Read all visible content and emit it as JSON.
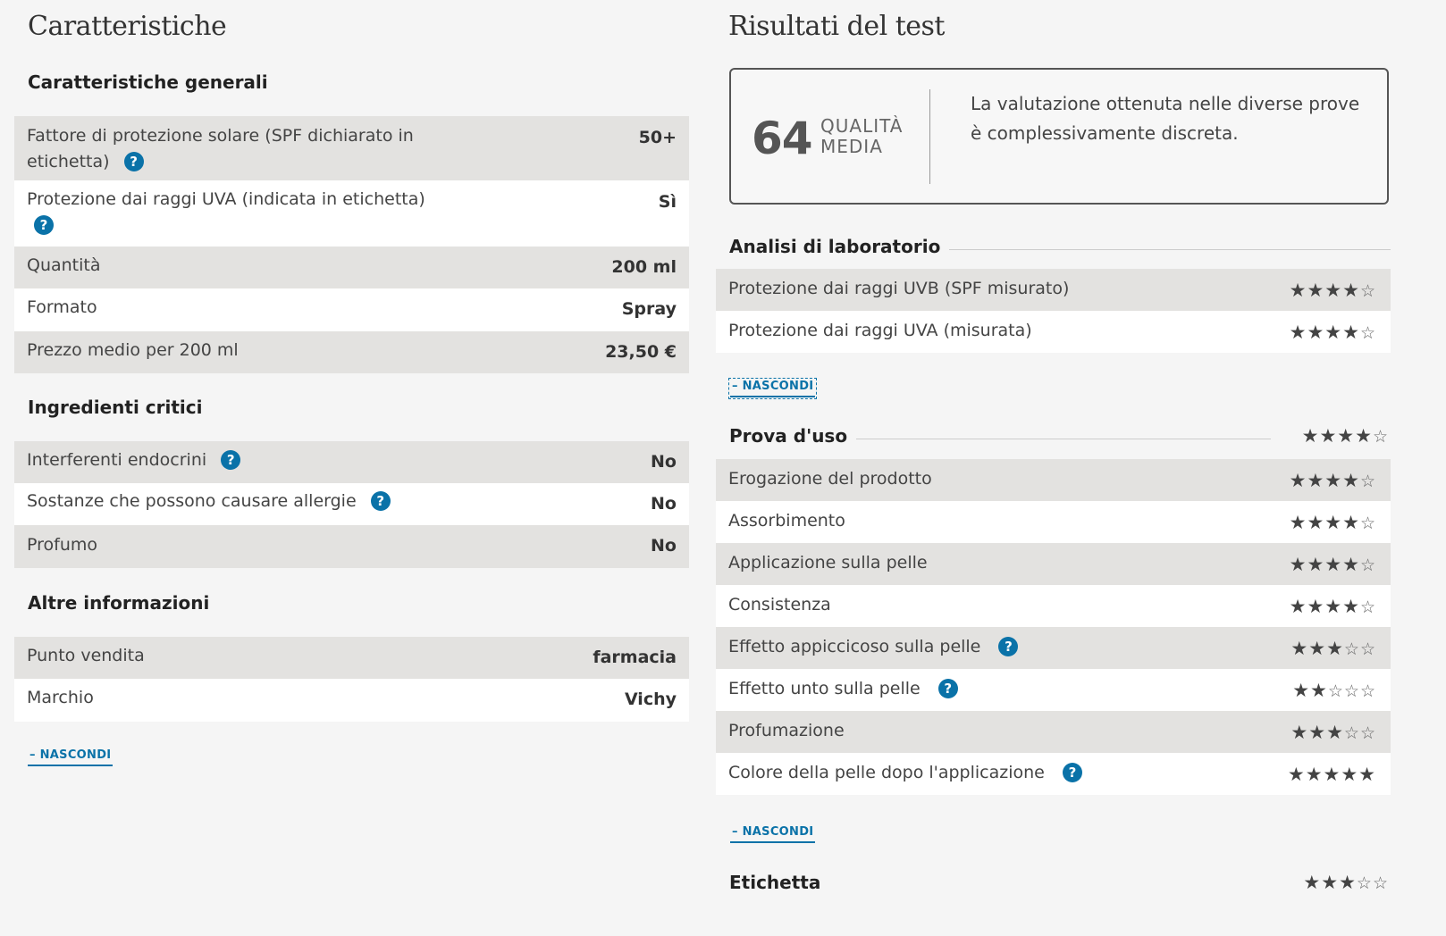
{
  "left": {
    "title": "Caratteristiche",
    "general": {
      "heading": "Caratteristiche generali",
      "rows": [
        {
          "label": "Fattore di protezione solare (SPF dichiarato in etichetta)",
          "value": "50+",
          "help": true
        },
        {
          "label": "Protezione dai raggi UVA (indicata in etichetta)",
          "value": "Sì",
          "help": true
        },
        {
          "label": "Quantità",
          "value": "200 ml",
          "help": false
        },
        {
          "label": "Formato",
          "value": "Spray",
          "help": false
        },
        {
          "label": "Prezzo medio per 200 ml",
          "value": "23,50 €",
          "help": false
        }
      ]
    },
    "critical": {
      "heading": "Ingredienti critici",
      "rows": [
        {
          "label": "Interferenti endocrini",
          "value": "No",
          "help": true
        },
        {
          "label": "Sostanze che possono causare allergie",
          "value": "No",
          "help": true
        },
        {
          "label": "Profumo",
          "value": "No",
          "help": false
        }
      ]
    },
    "other": {
      "heading": "Altre informazioni",
      "rows": [
        {
          "label": "Punto vendita",
          "value": "farmacia",
          "help": false
        },
        {
          "label": "Marchio",
          "value": "Vichy",
          "help": false
        }
      ]
    },
    "toggle_label": "– NASCONDI"
  },
  "right": {
    "title": "Risultati del test",
    "score": {
      "value": "64",
      "label_line1": "QUALITÀ",
      "label_line2": "MEDIA",
      "description": "La valutazione ottenuta nelle diverse prove è complessivamente discreta."
    },
    "lab": {
      "heading": "Analisi di laboratorio",
      "rows": [
        {
          "label": "Protezione dai raggi UVB (SPF misurato)",
          "rating": 4,
          "help": false
        },
        {
          "label": "Protezione dai raggi UVA (misurata)",
          "rating": 4,
          "help": false
        }
      ],
      "toggle_label": "– NASCONDI"
    },
    "usage": {
      "heading": "Prova d'uso",
      "rating": 4,
      "rows": [
        {
          "label": "Erogazione del prodotto",
          "rating": 4,
          "help": false
        },
        {
          "label": "Assorbimento",
          "rating": 4,
          "help": false
        },
        {
          "label": "Applicazione sulla pelle",
          "rating": 4,
          "help": false
        },
        {
          "label": "Consistenza",
          "rating": 4,
          "help": false
        },
        {
          "label": "Effetto appiccicoso sulla pelle",
          "rating": 3,
          "help": true
        },
        {
          "label": "Effetto unto sulla pelle",
          "rating": 2,
          "help": true
        },
        {
          "label": "Profumazione",
          "rating": 3,
          "help": false
        },
        {
          "label": "Colore della pelle dopo l'applicazione",
          "rating": 5,
          "help": true
        }
      ],
      "toggle_label": "– NASCONDI"
    },
    "label_section": {
      "heading": "Etichetta",
      "rating": 3
    },
    "max_rating": 5
  },
  "icons": {
    "help": "question-mark-icon",
    "star_full": "star-filled-icon",
    "star_empty": "star-outline-icon"
  },
  "colors": {
    "accent": "#0a72a8",
    "row_alt": "#e3e2e0",
    "row": "#ffffff",
    "background": "#f5f5f5"
  }
}
